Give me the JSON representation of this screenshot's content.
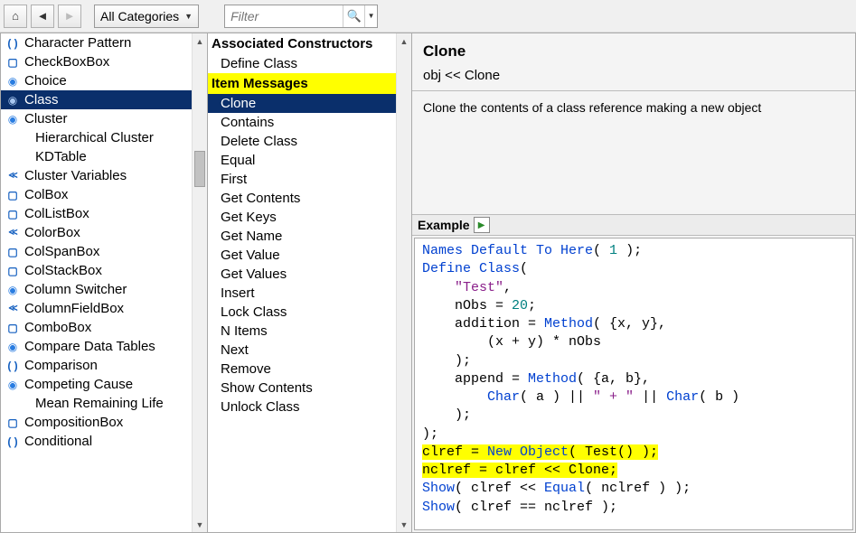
{
  "toolbar": {
    "category_label": "All Categories",
    "filter_placeholder": "Filter"
  },
  "categories": [
    {
      "icon": "paren",
      "label": "Character Pattern",
      "indent": false
    },
    {
      "icon": "box",
      "label": "CheckBoxBox",
      "indent": false
    },
    {
      "icon": "glb",
      "label": "Choice",
      "indent": false
    },
    {
      "icon": "glb",
      "label": "Class",
      "indent": false,
      "selected": true
    },
    {
      "icon": "glb",
      "label": "Cluster",
      "indent": false
    },
    {
      "icon": "",
      "label": "Hierarchical Cluster",
      "indent": true
    },
    {
      "icon": "",
      "label": "KDTable",
      "indent": true
    },
    {
      "icon": "ltlt",
      "label": "Cluster Variables",
      "indent": false
    },
    {
      "icon": "box",
      "label": "ColBox",
      "indent": false
    },
    {
      "icon": "box",
      "label": "ColListBox",
      "indent": false
    },
    {
      "icon": "ltlt",
      "label": "ColorBox",
      "indent": false
    },
    {
      "icon": "box",
      "label": "ColSpanBox",
      "indent": false
    },
    {
      "icon": "box",
      "label": "ColStackBox",
      "indent": false
    },
    {
      "icon": "glb",
      "label": "Column Switcher",
      "indent": false
    },
    {
      "icon": "ltlt",
      "label": "ColumnFieldBox",
      "indent": false
    },
    {
      "icon": "box",
      "label": "ComboBox",
      "indent": false
    },
    {
      "icon": "glb",
      "label": "Compare Data Tables",
      "indent": false
    },
    {
      "icon": "paren",
      "label": "Comparison",
      "indent": false
    },
    {
      "icon": "glb",
      "label": "Competing Cause",
      "indent": false
    },
    {
      "icon": "",
      "label": "Mean Remaining Life",
      "indent": true
    },
    {
      "icon": "box",
      "label": "CompositionBox",
      "indent": false
    },
    {
      "icon": "paren",
      "label": "Conditional",
      "indent": false
    }
  ],
  "mid": {
    "header1": "Associated Constructors",
    "header2": "Item Messages",
    "group1": [
      "Define Class"
    ],
    "group2": [
      {
        "label": "Clone",
        "selected": true
      },
      {
        "label": "Contains"
      },
      {
        "label": "Delete Class"
      },
      {
        "label": "Equal"
      },
      {
        "label": "First"
      },
      {
        "label": "Get Contents"
      },
      {
        "label": "Get Keys"
      },
      {
        "label": "Get Name"
      },
      {
        "label": "Get Value"
      },
      {
        "label": "Get Values"
      },
      {
        "label": "Insert"
      },
      {
        "label": "Lock Class"
      },
      {
        "label": "N Items"
      },
      {
        "label": "Next"
      },
      {
        "label": "Remove"
      },
      {
        "label": "Show Contents"
      },
      {
        "label": "Unlock Class"
      }
    ]
  },
  "detail": {
    "title": "Clone",
    "signature": "obj << Clone",
    "description": "Clone the contents of a class reference making a new object",
    "example_label": "Example"
  },
  "code_tokens": [
    {
      "t": "Names Default To Here",
      "c": "kw"
    },
    {
      "t": "( "
    },
    {
      "t": "1",
      "c": "num"
    },
    {
      "t": " );\n"
    },
    {
      "t": "Define Class",
      "c": "kw"
    },
    {
      "t": "(\n    "
    },
    {
      "t": "\"Test\"",
      "c": "str"
    },
    {
      "t": ",\n    nObs = "
    },
    {
      "t": "20",
      "c": "num"
    },
    {
      "t": ";\n    addition = "
    },
    {
      "t": "Method",
      "c": "kw"
    },
    {
      "t": "( {x, y},\n        (x + y) * nObs\n    );\n    append = "
    },
    {
      "t": "Method",
      "c": "kw"
    },
    {
      "t": "( {a, b},\n        "
    },
    {
      "t": "Char",
      "c": "kw"
    },
    {
      "t": "( a ) || "
    },
    {
      "t": "\" + \"",
      "c": "str"
    },
    {
      "t": " || "
    },
    {
      "t": "Char",
      "c": "kw"
    },
    {
      "t": "( b )\n    );\n);\n"
    },
    {
      "t": "clref = ",
      "c": "",
      "hl": true
    },
    {
      "t": "New Object",
      "c": "kw",
      "hl": true
    },
    {
      "t": "( Test() );",
      "hl": true
    },
    {
      "t": "\n"
    },
    {
      "t": "nclref = clref << Clone;",
      "hl": true
    },
    {
      "t": "\n"
    },
    {
      "t": "Show",
      "c": "kw"
    },
    {
      "t": "( clref << "
    },
    {
      "t": "Equal",
      "c": "kw"
    },
    {
      "t": "( nclref ) );\n"
    },
    {
      "t": "Show",
      "c": "kw"
    },
    {
      "t": "( clref == nclref );"
    }
  ]
}
